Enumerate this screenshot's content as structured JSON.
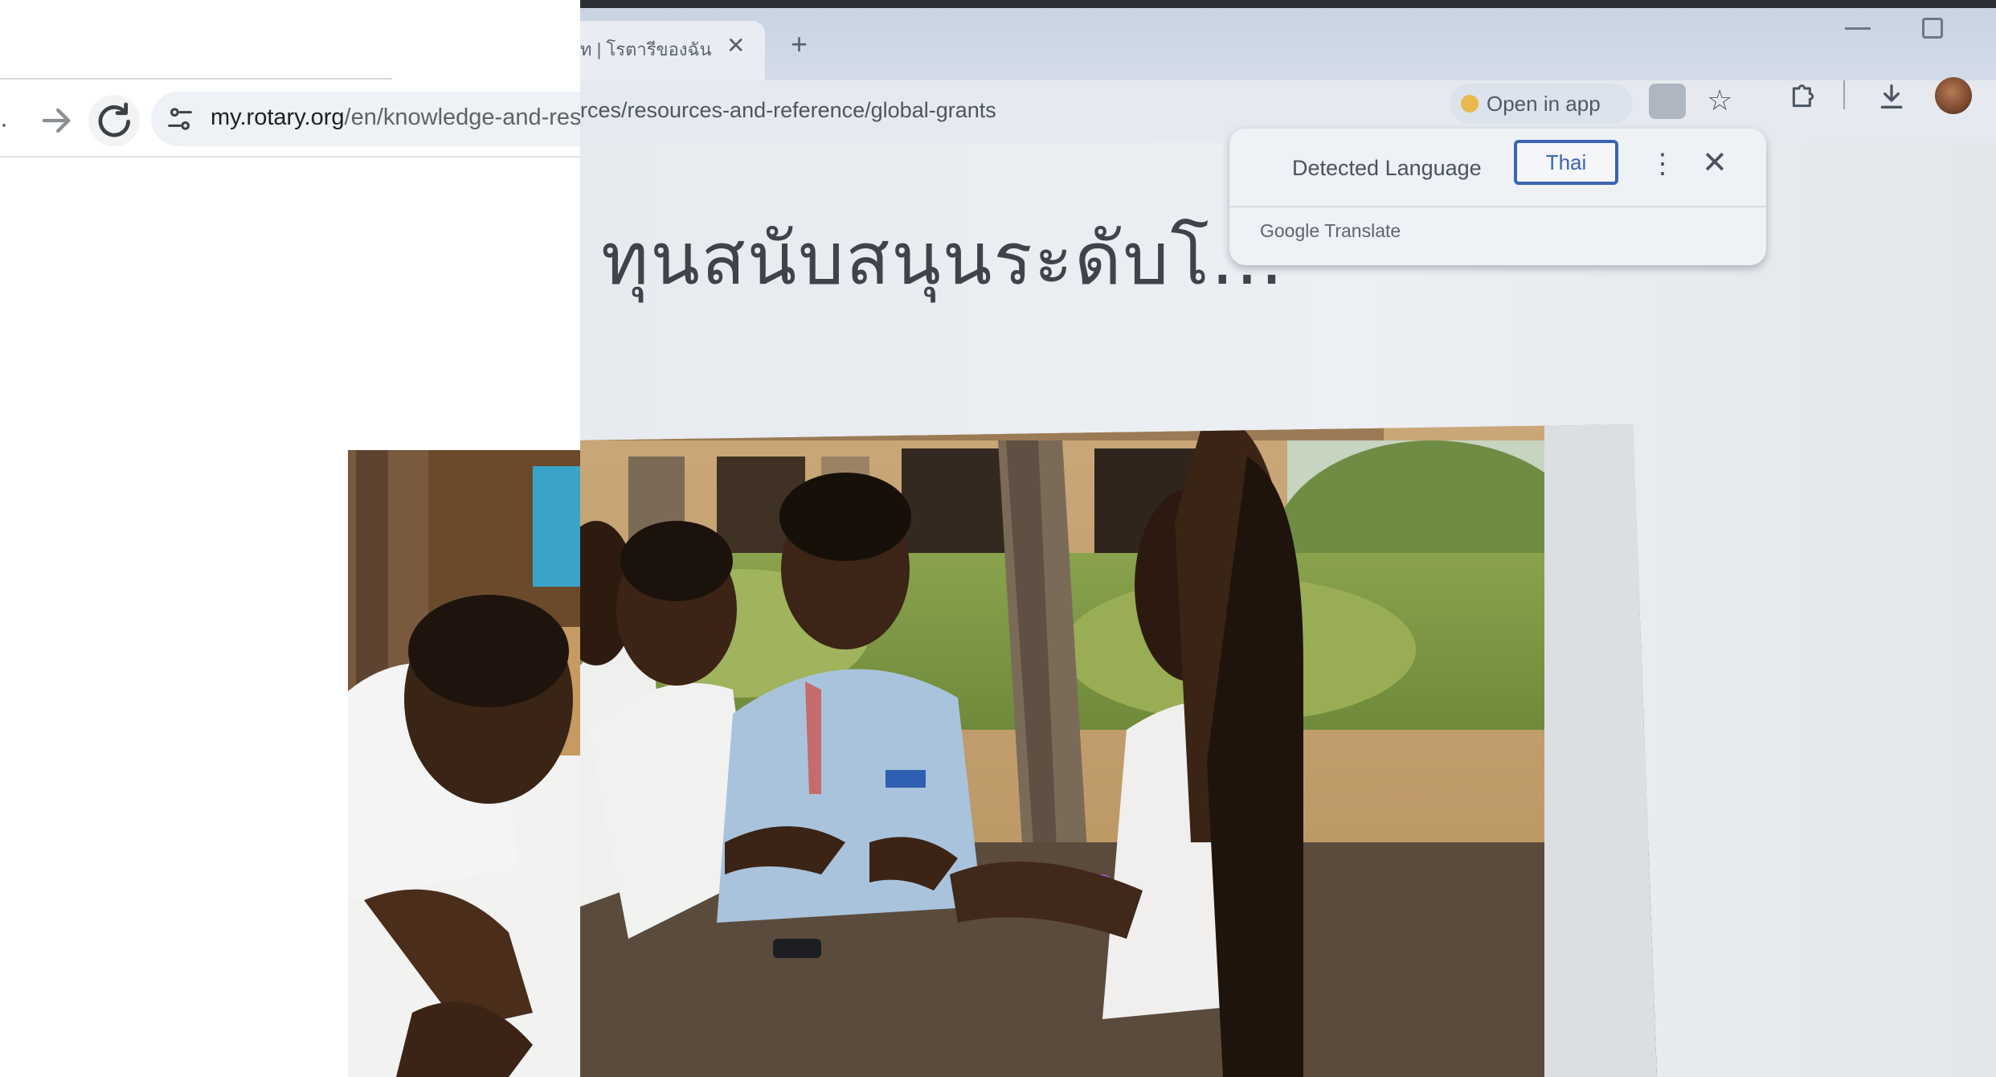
{
  "browser": {
    "url_host": "my.rotary.org",
    "url_path_left": "/en/knowledge-and-res",
    "url_path_right": "rces/resources-and-reference/global-grants",
    "tab_title": "ท | โรตารีของฉัน",
    "tab_close": "✕",
    "new_tab": "+",
    "open_in_app": "Open in app"
  },
  "translate_popup": {
    "detected_language": "Detected Language",
    "target_language": "Thai",
    "more": "⋮",
    "close": "✕",
    "brand": "Google Translate"
  },
  "page": {
    "heading": "ทุนสนับสนุนระดับโ..."
  },
  "icons": {
    "back_edge": "back-arrow-icon",
    "forward": "forward-arrow-icon",
    "reload": "reload-icon",
    "site_info": "tune-icon",
    "translate": "translate-icon",
    "bookmark": "star-icon",
    "extensions": "puzzle-icon",
    "downloads": "download-icon",
    "profile": "avatar"
  },
  "colors": {
    "accent": "#3d64b4",
    "tabstrip": "#c9d3e2",
    "omnibox": "#eef1f5"
  }
}
